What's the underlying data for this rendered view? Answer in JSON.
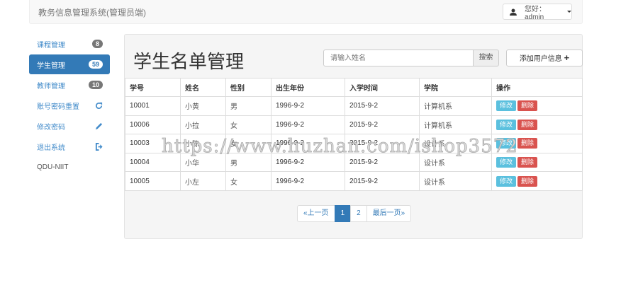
{
  "navbar": {
    "brand": "教务信息管理系统(管理员端)",
    "user_label": "您好：admin"
  },
  "sidebar": {
    "items": [
      {
        "label": "课程管理",
        "badge": "8"
      },
      {
        "label": "学生管理",
        "badge": "59"
      },
      {
        "label": "教师管理",
        "badge": "10"
      },
      {
        "label": "账号密码重置"
      },
      {
        "label": "修改密码"
      },
      {
        "label": "退出系统"
      }
    ],
    "footer": "QDU-NIIT"
  },
  "main": {
    "title": "学生名单管理",
    "search_placeholder": "请输入姓名",
    "search_label": "搜索",
    "add_label": "添加用户信息",
    "columns": [
      "学号",
      "姓名",
      "性别",
      "出生年份",
      "入学时间",
      "学院",
      "操作"
    ],
    "rows": [
      {
        "id": "10001",
        "name": "小黄",
        "sex": "男",
        "birth": "1996-9-2",
        "enroll": "2015-9-2",
        "dept": "计算机系"
      },
      {
        "id": "10006",
        "name": "小拉",
        "sex": "女",
        "birth": "1996-9-2",
        "enroll": "2015-9-2",
        "dept": "计算机系"
      },
      {
        "id": "10003",
        "name": "小陈",
        "sex": "女",
        "birth": "1996-9-2",
        "enroll": "2015-9-2",
        "dept": "设计系"
      },
      {
        "id": "10004",
        "name": "小华",
        "sex": "男",
        "birth": "1996-9-2",
        "enroll": "2015-9-2",
        "dept": "设计系"
      },
      {
        "id": "10005",
        "name": "小左",
        "sex": "女",
        "birth": "1996-9-2",
        "enroll": "2015-9-2",
        "dept": "设计系"
      }
    ],
    "edit_label": "修改",
    "delete_label": "删除",
    "pager": {
      "prev": "«上一页",
      "pages": [
        "1",
        "2"
      ],
      "current": "1",
      "last": "最后一页»"
    }
  },
  "watermark": "https://www.huzhan.com/ishop3572"
}
